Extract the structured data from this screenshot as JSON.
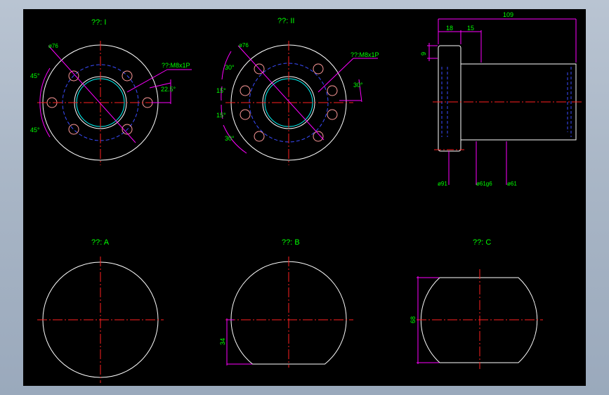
{
  "colors": {
    "background": "#000000",
    "outline": "#ffffff",
    "centerline": "#ff2020",
    "hidden": "#3a4cff",
    "dimension": "#ff00ff",
    "label": "#00ff00",
    "hole": "#ff9a9a",
    "bore": "#00ffff",
    "frame": "#a9b6c6"
  },
  "views": {
    "view1": {
      "title": "??: I",
      "dia": "ø76",
      "thread": "??:M8x1P",
      "angle_top": "45°",
      "angle_bottom": "45°",
      "angle_right": "22.5°"
    },
    "view2": {
      "title": "??: II",
      "dia": "ø76",
      "thread": "??:M8x1P",
      "angle_a": "30°",
      "angle_b": "15°",
      "angle_c": "15°",
      "angle_d": "30°",
      "angle_right": "30°"
    },
    "side": {
      "total_length": "109",
      "flange_width": "18",
      "step": "15",
      "flange_thickness": "9",
      "d1": "ø91",
      "d2": "ø61g6",
      "d3": "ø61"
    },
    "sectionA": {
      "title": "??: A"
    },
    "sectionB": {
      "title": "??: B",
      "height": "34"
    },
    "sectionC": {
      "title": "??: C",
      "width": "68"
    }
  }
}
